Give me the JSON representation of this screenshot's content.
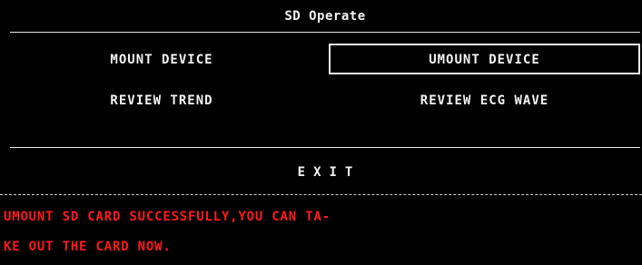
{
  "window": {
    "title": "SD Operate"
  },
  "menu": {
    "mount_label": "MOUNT DEVICE",
    "umount_label": "UMOUNT DEVICE",
    "review_trend_label": "REVIEW TREND",
    "review_ecg_label": "REVIEW ECG WAVE",
    "selected": "UMOUNT DEVICE",
    "exit_label": "EXIT"
  },
  "status": {
    "line1": "UMOUNT SD CARD SUCCESSFULLY,YOU CAN TA-",
    "line2": "KE OUT THE CARD NOW.",
    "color": "#ff1a1a"
  },
  "colors": {
    "background": "#000000",
    "foreground": "#f2f2f2",
    "message": "#ff1a1a"
  }
}
